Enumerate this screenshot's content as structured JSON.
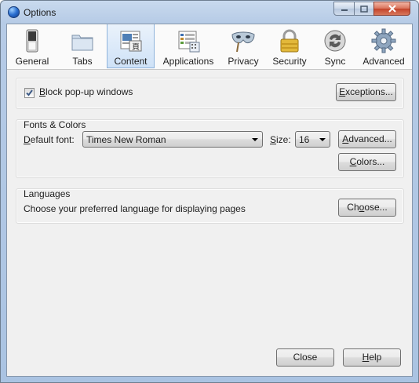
{
  "window": {
    "title": "Options"
  },
  "tabs": [
    {
      "label": "General",
      "icon": "switch-icon"
    },
    {
      "label": "Tabs",
      "icon": "tabs-folder-icon"
    },
    {
      "label": "Content",
      "icon": "content-page-icon",
      "selected": true
    },
    {
      "label": "Applications",
      "icon": "applications-list-icon"
    },
    {
      "label": "Privacy",
      "icon": "privacy-mask-icon"
    },
    {
      "label": "Security",
      "icon": "security-lock-icon"
    },
    {
      "label": "Sync",
      "icon": "sync-arrows-icon"
    },
    {
      "label": "Advanced",
      "icon": "advanced-gear-icon"
    }
  ],
  "popups": {
    "block_checked": true,
    "block_label_mnemonic": "B",
    "block_label_rest": "lock pop-up windows",
    "exceptions_button": {
      "mnemonic": "E",
      "rest": "xceptions..."
    }
  },
  "fonts": {
    "title": "Fonts & Colors",
    "default_font_label": {
      "mnemonic": "D",
      "rest": "efault font:"
    },
    "default_font_value": "Times New Roman",
    "size_label": {
      "mnemonic": "S",
      "rest": "ize:"
    },
    "size_value": "16",
    "advanced_button": {
      "mnemonic": "A",
      "rest": "dvanced..."
    },
    "colors_button": {
      "pre": "",
      "mnemonic": "C",
      "rest": "olors..."
    }
  },
  "languages": {
    "title": "Languages",
    "description": "Choose your preferred language for displaying pages",
    "choose_button": {
      "pre": "Ch",
      "mnemonic": "o",
      "rest": "ose..."
    }
  },
  "footer": {
    "close_button": "Close",
    "help_button": {
      "mnemonic": "H",
      "rest": "elp"
    }
  },
  "colors": {
    "titlebar": "#b9cde7",
    "client_bg": "#f0f0f0",
    "selected_tab": "#cfe2f7",
    "close_button_red": "#c3432a"
  }
}
